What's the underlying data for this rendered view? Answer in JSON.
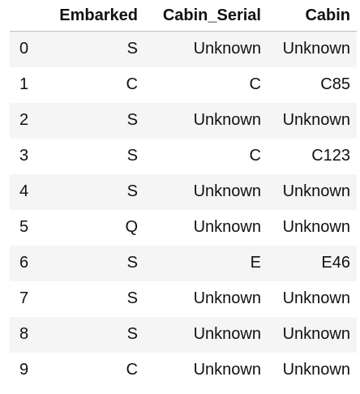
{
  "table": {
    "columns": [
      "",
      "Embarked",
      "Cabin_Serial",
      "Cabin"
    ],
    "rows": [
      [
        "0",
        "S",
        "Unknown",
        "Unknown"
      ],
      [
        "1",
        "C",
        "C",
        "C85"
      ],
      [
        "2",
        "S",
        "Unknown",
        "Unknown"
      ],
      [
        "3",
        "S",
        "C",
        "C123"
      ],
      [
        "4",
        "S",
        "Unknown",
        "Unknown"
      ],
      [
        "5",
        "Q",
        "Unknown",
        "Unknown"
      ],
      [
        "6",
        "S",
        "E",
        "E46"
      ],
      [
        "7",
        "S",
        "Unknown",
        "Unknown"
      ],
      [
        "8",
        "S",
        "Unknown",
        "Unknown"
      ],
      [
        "9",
        "C",
        "Unknown",
        "Unknown"
      ]
    ]
  }
}
